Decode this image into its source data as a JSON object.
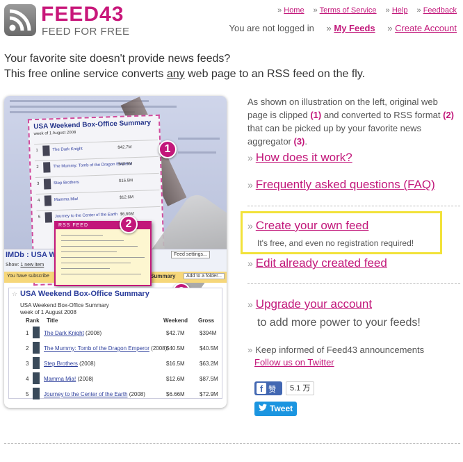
{
  "logo": {
    "title": "FEED43",
    "subtitle": "FEED FOR FREE",
    "icon": "rss-icon"
  },
  "top_nav": [
    {
      "label": "Home"
    },
    {
      "label": "Terms of Service"
    },
    {
      "label": "Help"
    },
    {
      "label": "Feedback"
    }
  ],
  "user": {
    "status": "You are not logged in",
    "my_feeds": "My Feeds",
    "create_account": "Create Account"
  },
  "intro": {
    "line1": "Your favorite site doesn't provide news feeds?",
    "line2_pre": "This free online service converts ",
    "line2_underline": "any",
    "line2_post": " web page to an RSS feed on the fly."
  },
  "illustration": {
    "card_title": "USA Weekend Box-Office Summary",
    "card_week": "week of 1 August 2008",
    "badges": [
      "1",
      "2",
      "3"
    ],
    "rss_label": "RSS FEED",
    "imdb_label": "IMDb : USA We",
    "feed_settings": "Feed settings...",
    "show_prefix": "Show: ",
    "show_link": "1 new item",
    "yellow_text": "You have subscribe",
    "yellow_summary": "Summary",
    "add_folder": "Add to a folder...",
    "reader_title": "USA Weekend Box-Office Summary",
    "reader_sub1": "USA Weekend Box-Office Summary",
    "reader_sub2": "week of 1 August 2008",
    "col_rank": "Rank",
    "col_title": "Title",
    "col_weekend": "Weekend",
    "col_gross": "Gross",
    "rows": [
      {
        "rank": "1",
        "title": "The Dark Knight",
        "year": "(2008)",
        "weekend": "$42.7M",
        "gross": "$394M"
      },
      {
        "rank": "2",
        "title": "The Mummy: Tomb of the Dragon Emperor",
        "year": "(2008)",
        "weekend": "$40.5M",
        "gross": "$40.5M"
      },
      {
        "rank": "3",
        "title": "Step Brothers",
        "year": "(2008)",
        "weekend": "$16.5M",
        "gross": "$63.2M"
      },
      {
        "rank": "4",
        "title": "Mamma Mia!",
        "year": "(2008)",
        "weekend": "$12.6M",
        "gross": "$87.5M"
      },
      {
        "rank": "5",
        "title": "Journey to the Center of the Earth",
        "year": "(2008)",
        "weekend": "$6.66M",
        "gross": "$72.9M"
      }
    ]
  },
  "side": {
    "desc_pre": "As shown on illustration on the left, original web page is clipped ",
    "desc_n1": "(1)",
    "desc_mid1": " and converted to RSS format ",
    "desc_n2": "(2)",
    "desc_mid2": " that can be picked up by your favorite news aggregator ",
    "desc_n3": "(3)",
    "desc_post": ".",
    "raquo": "»",
    "how": "How does it work?",
    "faq": "Frequently asked questions (FAQ)",
    "create": "Create your own feed",
    "create_sub": "It's free, and even no registration required!",
    "edit": "Edit already created feed",
    "upgrade": "Upgrade your account",
    "upgrade_sub": "to add more power to your feeds!",
    "keep": "Keep informed of Feed43 announcements",
    "twitter_follow": "Follow us on Twitter"
  },
  "social": {
    "fb_icon": "f",
    "fb_label": "赞",
    "fb_count": "5.1 万",
    "tweet": "Tweet",
    "tweet_icon": "twitter-bird-icon"
  },
  "colors": {
    "accent": "#c2177a",
    "highlight_box": "#f2e23a",
    "facebook": "#4267b2",
    "twitter": "#1b95e0"
  }
}
